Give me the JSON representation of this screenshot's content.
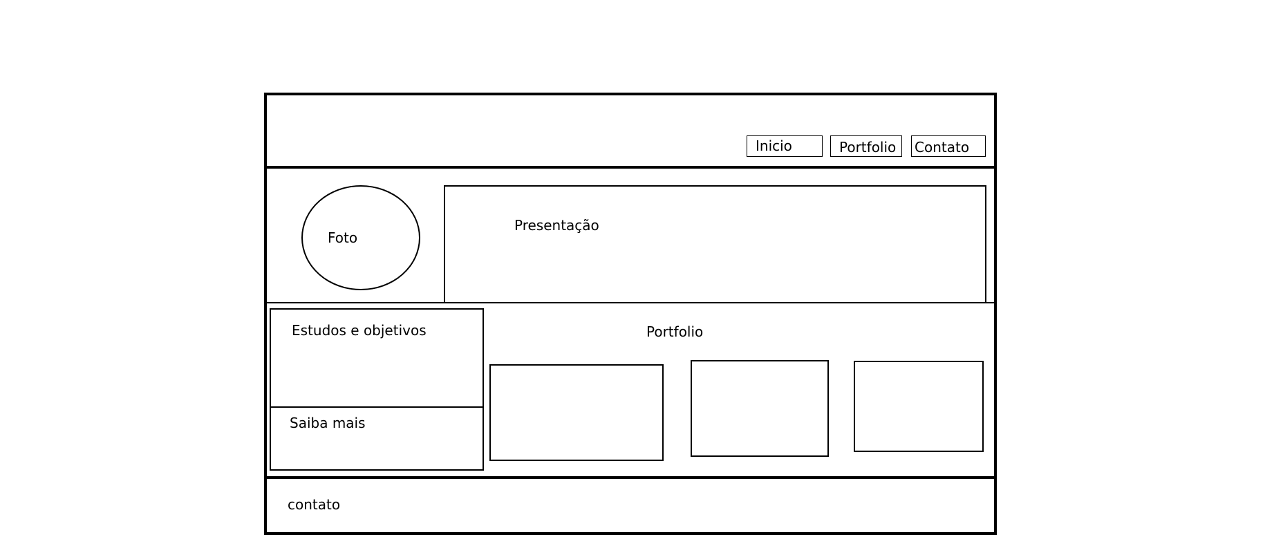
{
  "nav": {
    "inicio": "Inicio",
    "portfolio": "Portfolio",
    "contato": "Contato"
  },
  "hero": {
    "photo_label": "Foto",
    "presentation_label": "Presentação"
  },
  "main": {
    "studies_label": "Estudos e objetivos",
    "learn_more_label": "Saiba mais",
    "portfolio_title": "Portfolio"
  },
  "footer": {
    "contact_label": "contato"
  }
}
